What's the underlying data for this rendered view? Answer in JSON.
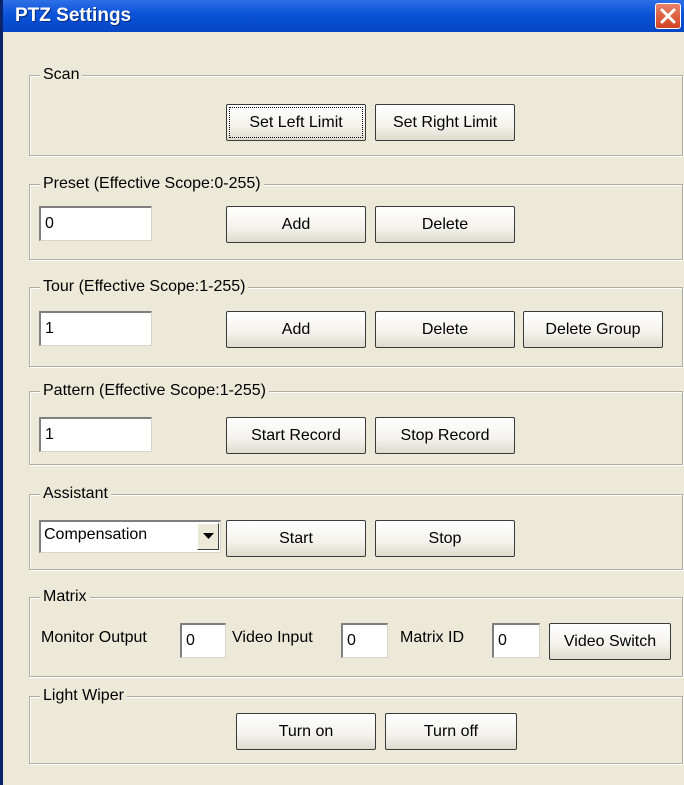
{
  "window": {
    "title": "PTZ Settings"
  },
  "scan": {
    "legend": "Scan",
    "set_left": "Set Left Limit",
    "set_right": "Set Right Limit"
  },
  "preset": {
    "legend": "Preset (Effective Scope:0-255)",
    "value": "0",
    "add": "Add",
    "delete": "Delete"
  },
  "tour": {
    "legend": "Tour (Effective Scope:1-255)",
    "value": "1",
    "add": "Add",
    "delete": "Delete",
    "delete_group": "Delete Group"
  },
  "pattern": {
    "legend": "Pattern (Effective Scope:1-255)",
    "value": "1",
    "start_record": "Start Record",
    "stop_record": "Stop Record"
  },
  "assistant": {
    "legend": "Assistant",
    "selected": "Compensation",
    "start": "Start",
    "stop": "Stop"
  },
  "matrix": {
    "legend": "Matrix",
    "monitor_output_label": "Monitor Output",
    "monitor_output_value": "0",
    "video_input_label": "Video Input",
    "video_input_value": "0",
    "matrix_id_label": "Matrix ID",
    "matrix_id_value": "0",
    "video_switch": "Video Switch"
  },
  "light_wiper": {
    "legend": "Light Wiper",
    "turn_on": "Turn on",
    "turn_off": "Turn off"
  },
  "colors": {
    "title_bar": "#0A53D8",
    "face": "#ECE9D8",
    "close": "#D2421E"
  },
  "icons": {
    "close": "close-icon",
    "dropdown": "chevron-down-icon"
  }
}
